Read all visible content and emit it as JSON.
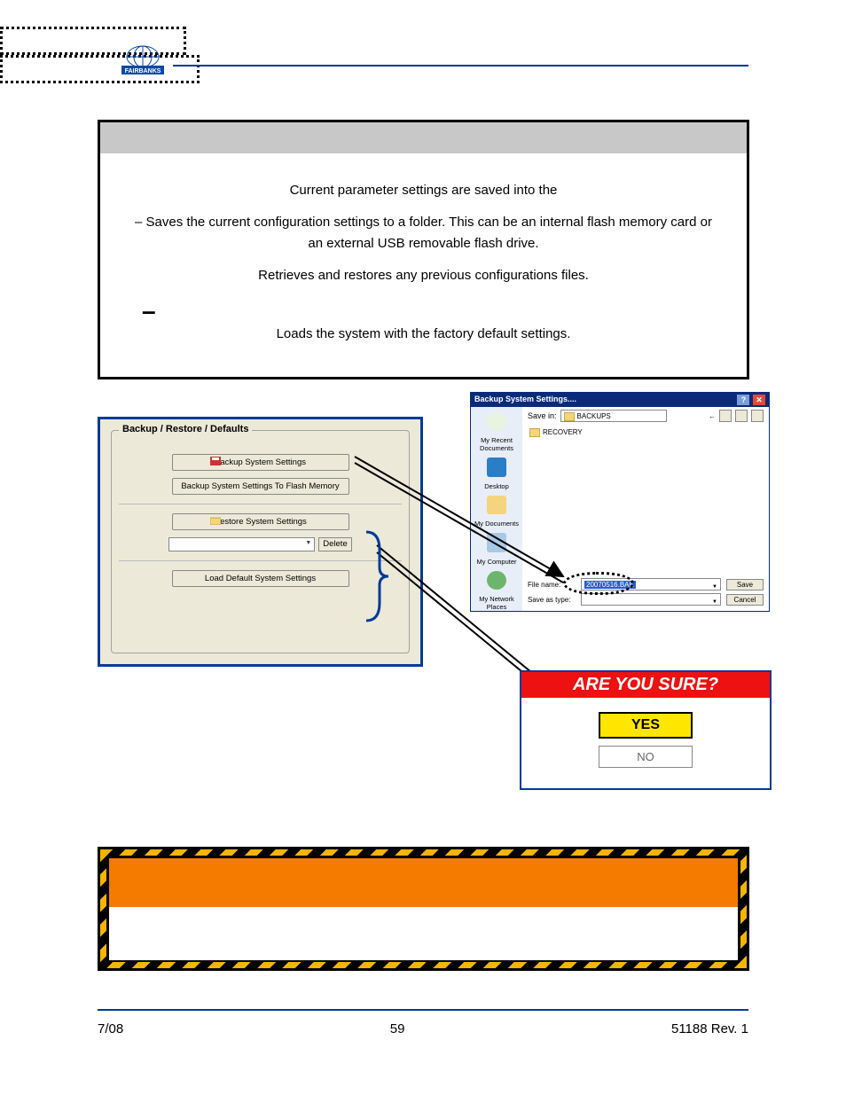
{
  "logo_text": "FAIRBANKS",
  "info": {
    "line1": "Current parameter settings are saved into the",
    "line2": "– Saves the current configuration settings to a folder.  This can be an internal flash memory card or an external USB removable flash drive.",
    "line3": "Retrieves and restores any previous configurations files.",
    "line4": "Loads the system with the factory default settings."
  },
  "panel": {
    "legend": "Backup / Restore / Defaults",
    "btn_backup": "Backup System Settings",
    "btn_backup_flash": "Backup System Settings To Flash Memory",
    "btn_restore": "Restore System Settings",
    "btn_delete": "Delete",
    "btn_defaults": "Load Default System Settings"
  },
  "savedlg": {
    "title": "Backup System Settings....",
    "save_in_label": "Save in:",
    "save_in_value": "BACKUPS",
    "nav": [
      "My Recent Documents",
      "Desktop",
      "My Documents",
      "My Computer",
      "My Network Places"
    ],
    "folder": "RECOVERY",
    "filename_label": "File name:",
    "filename_value": "20070516.BAK",
    "type_label": "Save as type:",
    "btn_save": "Save",
    "btn_cancel": "Cancel"
  },
  "confirm": {
    "header": "ARE YOU SURE?",
    "yes": "YES",
    "no": "NO"
  },
  "footer": {
    "left": "7/08",
    "center": "59",
    "right": "51188    Rev. 1"
  }
}
